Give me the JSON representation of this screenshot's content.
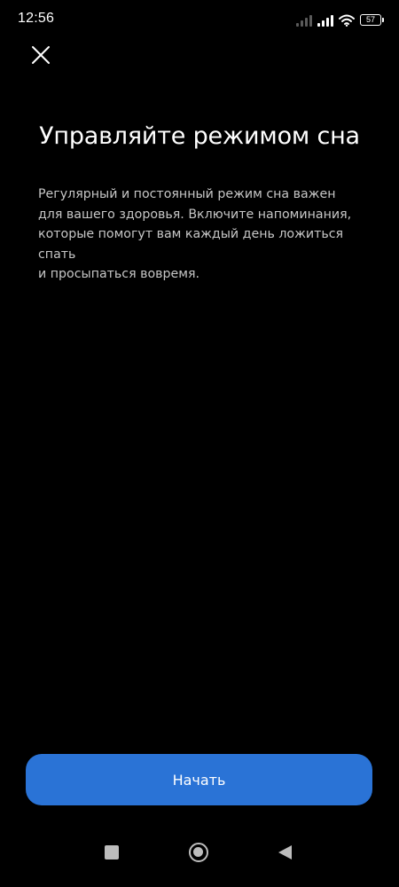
{
  "status_bar": {
    "time": "12:56",
    "battery_level": "57",
    "signal_icon_1": "cell-signal-icon",
    "signal_icon_2": "cell-signal-icon",
    "wifi_icon": "wifi-icon"
  },
  "header": {
    "close_icon": "close-icon"
  },
  "main": {
    "title": "Управляйте режимом сна",
    "description_lines": [
      "Регулярный и постоянный режим сна важен",
      "для вашего здоровья. Включите напоминания,",
      "которые помогут вам каждый день ложиться спать",
      "и просыпаться вовремя."
    ]
  },
  "footer": {
    "start_label": "Начать"
  },
  "nav_bar": {
    "recent_icon": "recent-apps-icon",
    "home_icon": "home-icon",
    "back_icon": "back-icon"
  },
  "colors": {
    "background": "#000000",
    "accent": "#2a73d6",
    "text": "#ffffff",
    "secondary_text": "#c7c7c7"
  }
}
